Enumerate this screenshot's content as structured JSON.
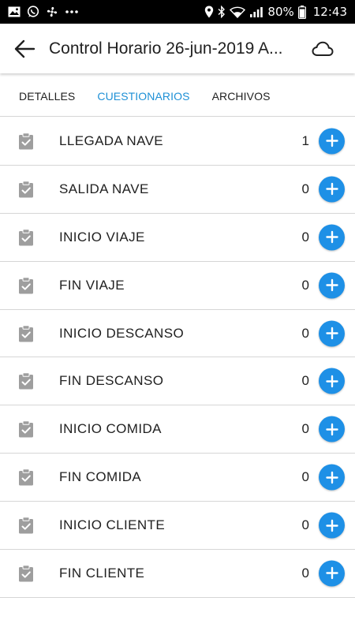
{
  "status_bar": {
    "battery": "80%",
    "time": "12:43",
    "left_icons": [
      "image-icon",
      "whatsapp-icon",
      "fan-icon",
      "more-dots-icon"
    ],
    "right_icons": [
      "location-icon",
      "bluetooth-icon",
      "wifi-icon",
      "signal-icon",
      "battery-icon"
    ]
  },
  "app_bar": {
    "title": "Control Horario 26-jun-2019 A..."
  },
  "tabs": [
    {
      "label": "DETALLES",
      "active": false
    },
    {
      "label": "CUESTIONARIOS",
      "active": true
    },
    {
      "label": "ARCHIVOS",
      "active": false
    }
  ],
  "questionnaires": [
    {
      "label": "LLEGADA NAVE",
      "count": "1"
    },
    {
      "label": "SALIDA NAVE",
      "count": "0"
    },
    {
      "label": "INICIO VIAJE",
      "count": "0"
    },
    {
      "label": "FIN VIAJE",
      "count": "0"
    },
    {
      "label": "INICIO DESCANSO",
      "count": "0"
    },
    {
      "label": "FIN DESCANSO",
      "count": "0"
    },
    {
      "label": "INICIO COMIDA",
      "count": "0"
    },
    {
      "label": "FIN COMIDA",
      "count": "0"
    },
    {
      "label": "INICIO CLIENTE",
      "count": "0"
    },
    {
      "label": "FIN CLIENTE",
      "count": "0"
    }
  ],
  "colors": {
    "accent": "#1e90e6",
    "active_tab": "#1e90d6",
    "icon_gray": "#9e9e9e",
    "divider": "#d6d6d6"
  }
}
